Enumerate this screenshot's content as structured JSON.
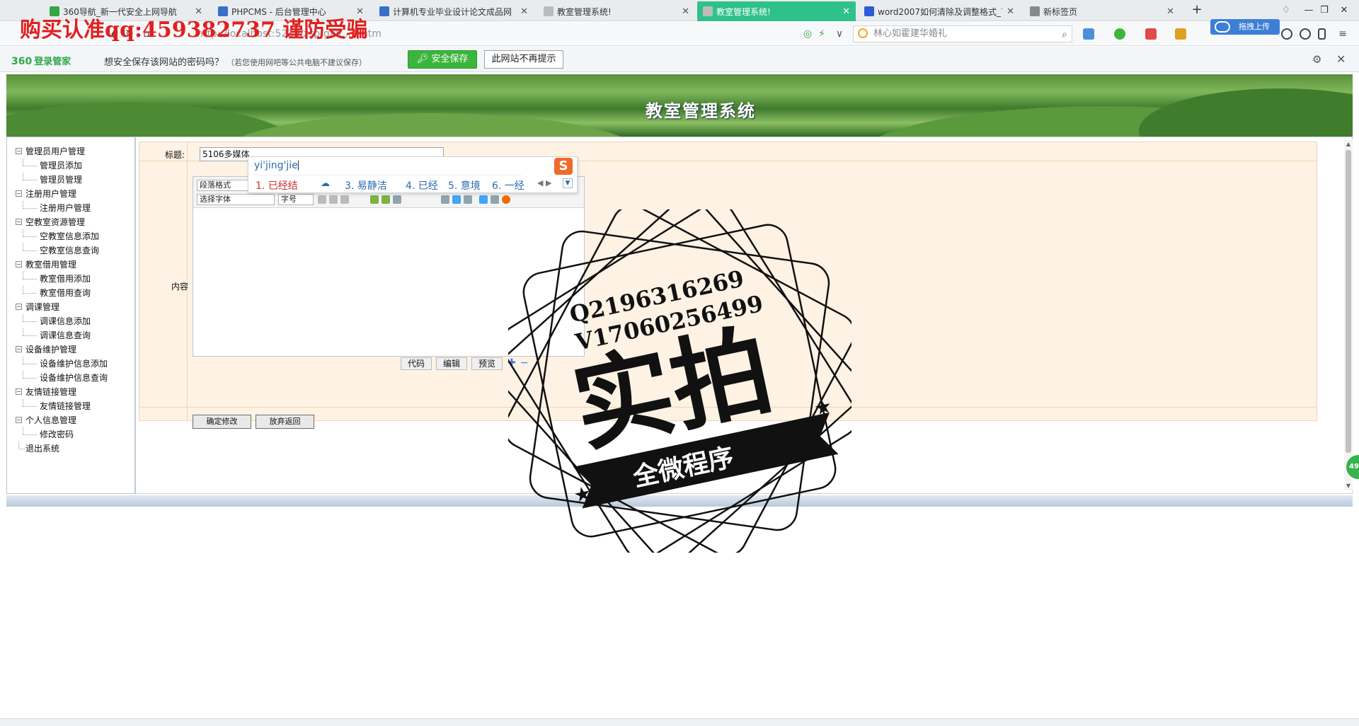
{
  "browser": {
    "tabs": [
      {
        "label": "360导航_新一代安全上网导航",
        "icon": "360-icon",
        "active": false
      },
      {
        "label": "PHPCMS - 后台管理中心",
        "icon": "pc-icon",
        "active": false
      },
      {
        "label": "计算机专业毕业设计论文成品网",
        "icon": "pc-icon",
        "active": false
      },
      {
        "label": "教室管理系统!",
        "icon": "page-icon",
        "active": false
      },
      {
        "label": "教室管理系统!",
        "icon": "page-icon",
        "active": true
      },
      {
        "label": "word2007如何清除及调整格式_百",
        "icon": "baidu-icon",
        "active": false
      },
      {
        "label": "新标签页",
        "icon": "grid-icon",
        "active": false
      }
    ],
    "new_tab": "+",
    "url": "http://localhost:5219/zsp/gai/....t.htm",
    "search_placeholder": "林心如霍建华婚礼",
    "upload_label": "拖拽上传"
  },
  "password_bar": {
    "logo": "360",
    "logo_sub": "登录管家",
    "prompt": "想安全保存该网站的密码吗？",
    "note": "（若您使用网吧等公共电脑不建议保存）",
    "save_label": "安全保存",
    "never_label": "此网站不再提示"
  },
  "page": {
    "header_title": "教室管理系统",
    "nav": [
      {
        "label": "管理员用户管理",
        "level": 0
      },
      {
        "label": "管理员添加",
        "level": 1
      },
      {
        "label": "管理员管理",
        "level": 1
      },
      {
        "label": "注册用户管理",
        "level": 0
      },
      {
        "label": "注册用户管理",
        "level": 1
      },
      {
        "label": "空教室资源管理",
        "level": 0
      },
      {
        "label": "空教室信息添加",
        "level": 1
      },
      {
        "label": "空教室信息查询",
        "level": 1
      },
      {
        "label": "教室借用管理",
        "level": 0
      },
      {
        "label": "教室借用添加",
        "level": 1
      },
      {
        "label": "教室借用查询",
        "level": 1
      },
      {
        "label": "调课管理",
        "level": 0
      },
      {
        "label": "调课信息添加",
        "level": 1
      },
      {
        "label": "调课信息查询",
        "level": 1
      },
      {
        "label": "设备维护管理",
        "level": 0
      },
      {
        "label": "设备维护信息添加",
        "level": 1
      },
      {
        "label": "设备维护信息查询",
        "level": 1
      },
      {
        "label": "友情链接管理",
        "level": 0
      },
      {
        "label": "友情链接管理",
        "level": 1
      },
      {
        "label": "个人信息管理",
        "level": 0
      },
      {
        "label": "修改密码",
        "level": 1
      },
      {
        "label": "退出系统",
        "level": 2
      }
    ],
    "form": {
      "title_label": "标题:",
      "title_value": "5106多媒体",
      "content_label": "内容",
      "paragraph_format": "段落格式",
      "font_select": "选择字体",
      "font_size": "字号",
      "mode_code": "代码",
      "mode_edit": "编辑",
      "mode_preview": "预览",
      "submit_label": "确定修改",
      "cancel_label": "放弃返回"
    }
  },
  "ime": {
    "pinyin": "yi'jing'jie",
    "candidates": [
      "1. 已经结",
      "3. 易静洁",
      "4. 已经",
      "5. 意境",
      "6. 一经"
    ],
    "logo": "S"
  },
  "overlay": {
    "watermark_text": "购买认准qq:459382737  谨防受骗",
    "stamp_line1": "Q2196316269",
    "stamp_line2": "V1706025649​9",
    "stamp_big": "实拍",
    "stamp_ribbon": "全微程序"
  },
  "side_badge": "49"
}
